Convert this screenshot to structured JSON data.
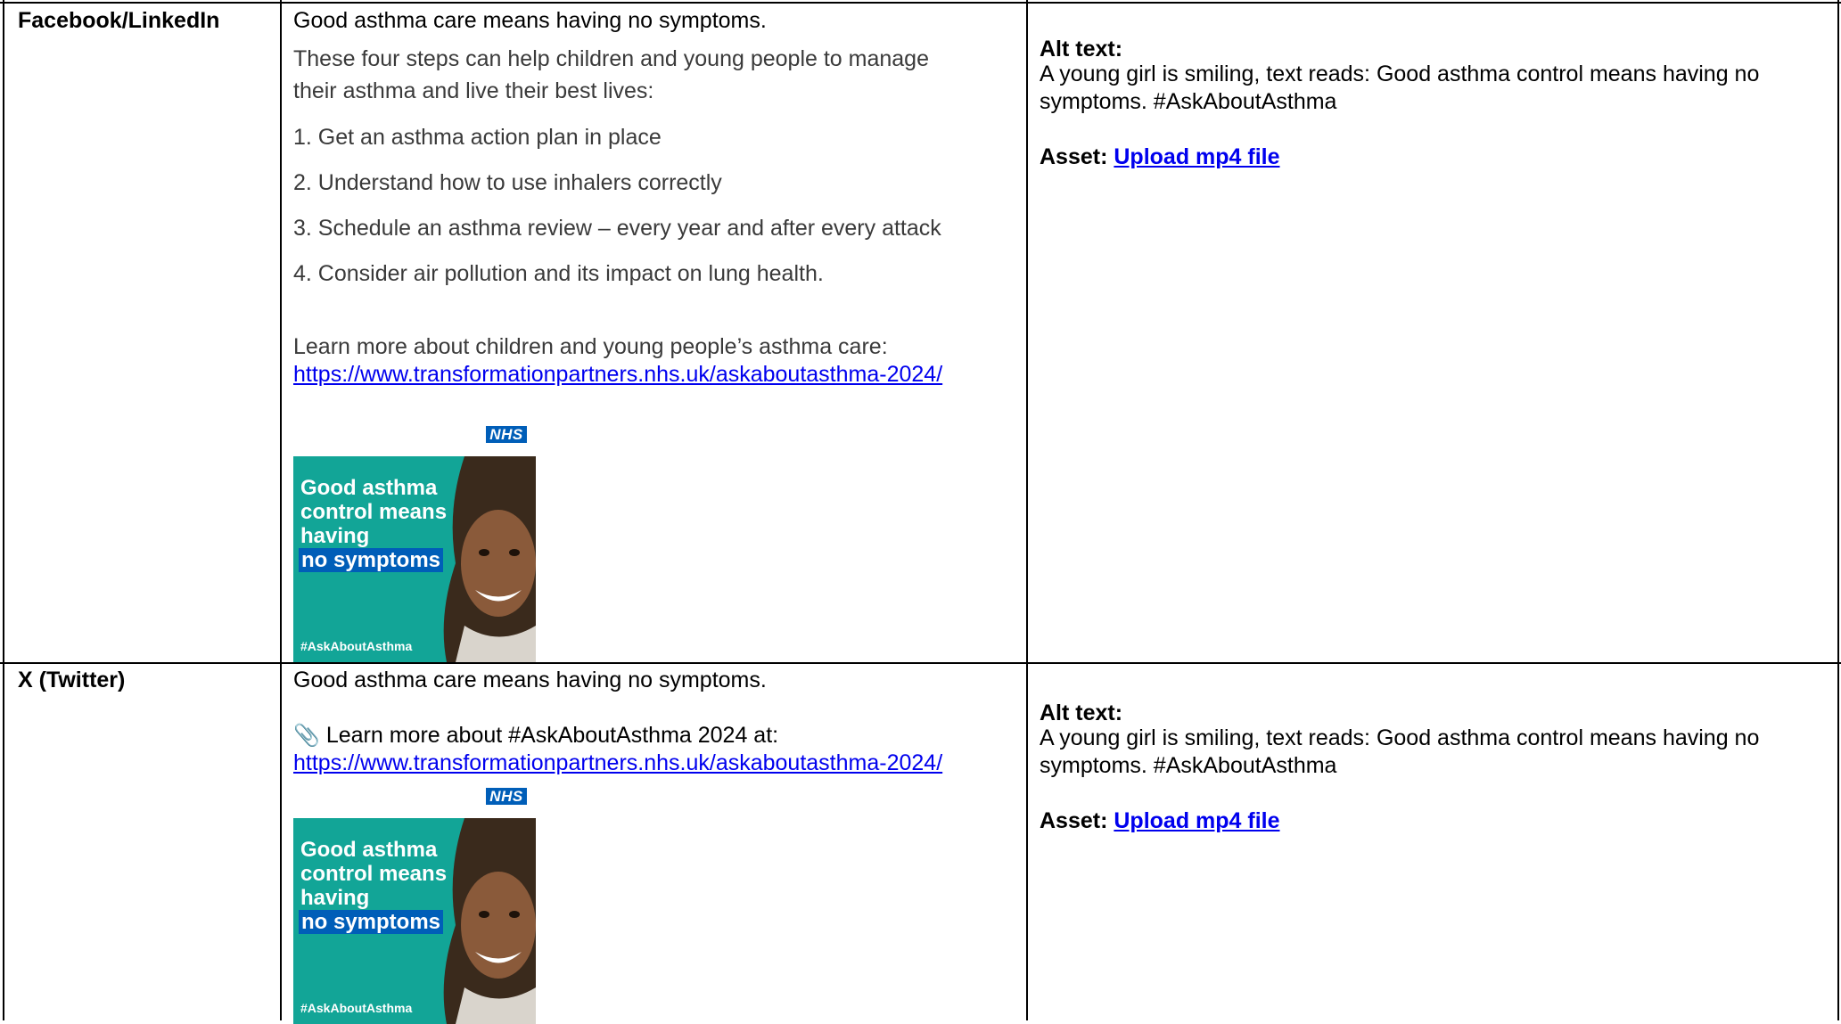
{
  "rows": [
    {
      "platform": "Facebook/LinkedIn",
      "headline": "Good asthma care means having no symptoms.",
      "intro": [
        "These four steps can help children and young people to manage",
        "their asthma and live their best lives:"
      ],
      "steps": [
        "1. Get an asthma action plan in place",
        "2. Understand how to use inhalers correctly",
        "3. Schedule an asthma review – every year and after every attack",
        "4. Consider air pollution and its impact on lung health."
      ],
      "learn_more": "Learn more about children and young people’s asthma care:",
      "url": "https://www.transformationpartners.nhs.uk/askaboutasthma-2024/",
      "alt_text_label": "Alt text:",
      "alt_text": [
        "A young girl is smiling, text reads: Good asthma control means having no",
        "symptoms. #AskAboutAsthma"
      ],
      "asset_label": "Asset:",
      "asset_link": "Upload mp4 file"
    },
    {
      "platform": "X (Twitter)",
      "headline": "Good asthma care means having no symptoms.",
      "learn_more": "Learn more about #AskAboutAsthma 2024 at:",
      "url": "https://www.transformationpartners.nhs.uk/askaboutasthma-2024/",
      "alt_text_label": "Alt text:",
      "alt_text": [
        "A young girl is smiling, text reads: Good asthma control means having no",
        "symptoms. #AskAboutAsthma"
      ],
      "asset_label": "Asset:",
      "asset_link": "Upload mp4 file"
    }
  ],
  "poster": {
    "nhs_logo": "NHS",
    "lines": [
      "Good asthma",
      "control means",
      "having"
    ],
    "highlight": "no symptoms",
    "hashtag": "#AskAboutAsthma"
  },
  "icons": {
    "clip": "paperclip-icon"
  },
  "colors": {
    "teal": "#12a597",
    "nhs_blue": "#005eb8",
    "link": "#0000ee"
  }
}
